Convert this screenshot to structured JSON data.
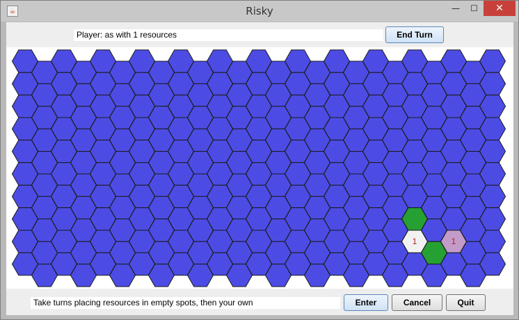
{
  "window": {
    "title": "Risky",
    "icon": "java-cup-icon",
    "controls": {
      "minimize": "—",
      "maximize": "☐",
      "close": "✕"
    }
  },
  "top": {
    "player_text": "Player: as with 1 resources",
    "end_turn_label": "End Turn"
  },
  "board": {
    "columns": 25,
    "rows": 10,
    "default_color": "#4c4ce4",
    "stroke_color": "#1a1a1a",
    "special_cells": [
      {
        "col": 20,
        "row": 7,
        "color": "#26a033",
        "label": ""
      },
      {
        "col": 21,
        "row": 8,
        "color": "#26a033",
        "label": ""
      },
      {
        "col": 20,
        "row": 8,
        "color": "#f2f2f2",
        "label": "1"
      },
      {
        "col": 22,
        "row": 8,
        "color": "#c29bc9",
        "label": "1"
      }
    ],
    "label_color": "#b02020"
  },
  "bottom": {
    "message": "Take turns placing resources in empty spots, then your own",
    "enter_label": "Enter",
    "cancel_label": "Cancel",
    "quit_label": "Quit"
  }
}
